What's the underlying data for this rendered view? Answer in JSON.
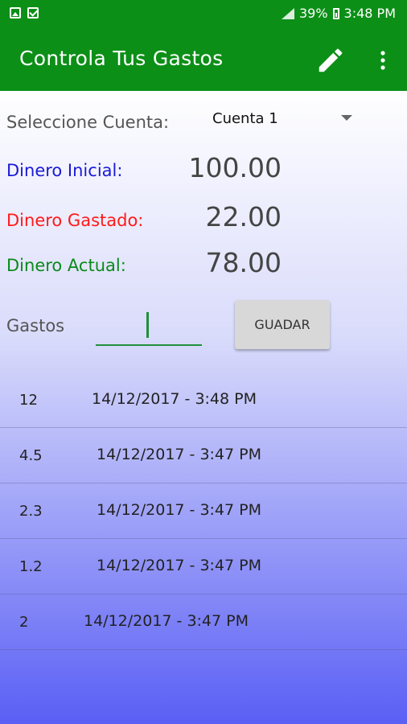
{
  "status": {
    "battery": "39%",
    "time": "3:48 PM"
  },
  "app_bar": {
    "title": "Controla Tus Gastos",
    "edit_icon": "pencil-icon",
    "menu_icon": "more-vert-icon"
  },
  "colors": {
    "app_bar": "#0c8f17",
    "dinero_inicial": "#1a1ad6",
    "dinero_gastado": "#ff1a1a",
    "dinero_actual": "#0a8a1a"
  },
  "account": {
    "label": "Seleccione Cuenta:",
    "selected": "Cuenta 1"
  },
  "summary": {
    "inicial_label": "Dinero Inicial:",
    "inicial_value": "100.00",
    "gastado_label": "Dinero Gastado:",
    "gastado_value": "22.00",
    "actual_label": "Dinero Actual:",
    "actual_value": "78.00"
  },
  "gastos": {
    "label": "Gastos",
    "input_value": "",
    "button_label": "GUADAR"
  },
  "expenses": [
    {
      "amount": "12",
      "date": "14/12/2017 - 3:48 PM"
    },
    {
      "amount": "4.5",
      "date": "14/12/2017 - 3:47 PM"
    },
    {
      "amount": "2.3",
      "date": "14/12/2017 - 3:47 PM"
    },
    {
      "amount": "1.2",
      "date": "14/12/2017 - 3:47 PM"
    },
    {
      "amount": "2",
      "date": "14/12/2017 - 3:47 PM"
    }
  ]
}
